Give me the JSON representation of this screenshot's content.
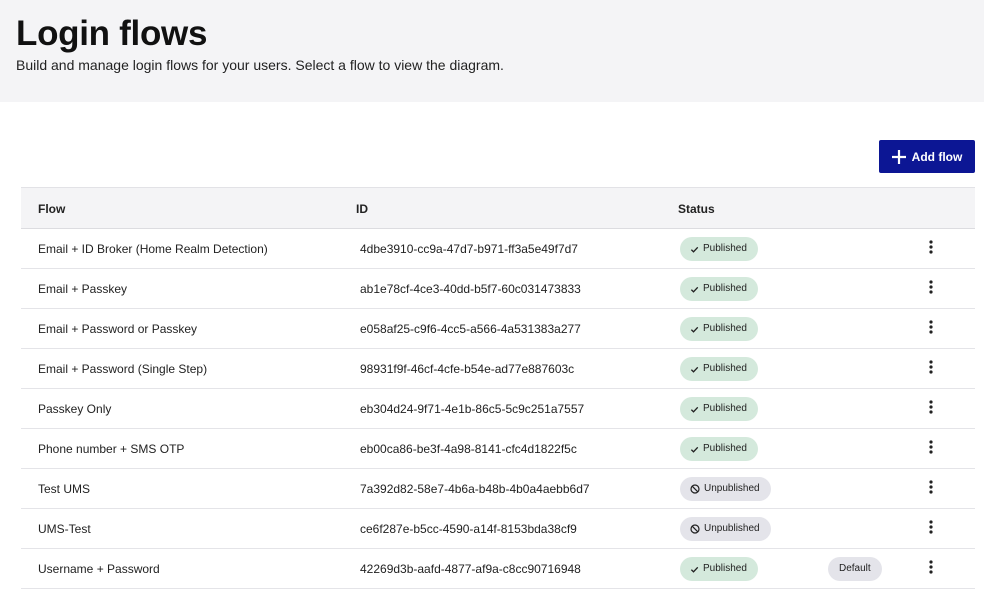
{
  "header": {
    "title": "Login flows",
    "subtitle": "Build and manage login flows for your users. Select a flow to view the diagram."
  },
  "toolbar": {
    "add_label": "Add flow",
    "add_icon": "plus-icon"
  },
  "table": {
    "columns": [
      "Flow",
      "ID",
      "Status"
    ],
    "rows": [
      {
        "flow": "Email + ID Broker (Home Realm Detection)",
        "id": "4dbe3910-cc9a-47d7-b971-ff3a5e49f7d7",
        "status": "Published",
        "default": ""
      },
      {
        "flow": "Email + Passkey",
        "id": "ab1e78cf-4ce3-40dd-b5f7-60c031473833",
        "status": "Published",
        "default": ""
      },
      {
        "flow": "Email + Password or Passkey",
        "id": "e058af25-c9f6-4cc5-a566-4a531383a277",
        "status": "Published",
        "default": ""
      },
      {
        "flow": "Email + Password (Single Step)",
        "id": "98931f9f-46cf-4cfe-b54e-ad77e887603c",
        "status": "Published",
        "default": ""
      },
      {
        "flow": "Passkey Only",
        "id": "eb304d24-9f71-4e1b-86c5-5c9c251a7557",
        "status": "Published",
        "default": ""
      },
      {
        "flow": "Phone number + SMS OTP",
        "id": "eb00ca86-be3f-4a98-8141-cfc4d1822f5c",
        "status": "Published",
        "default": ""
      },
      {
        "flow": "Test UMS",
        "id": "7a392d82-58e7-4b6a-b48b-4b0a4aebb6d7",
        "status": "Unpublished",
        "default": ""
      },
      {
        "flow": "UMS-Test",
        "id": "ce6f287e-b5cc-4590-a14f-8153bda38cf9",
        "status": "Unpublished",
        "default": ""
      },
      {
        "flow": "Username + Password",
        "id": "42269d3b-aafd-4877-af9a-c8cc90716948",
        "status": "Published",
        "default": "Default"
      }
    ]
  },
  "colors": {
    "primary_button": "#0c1694",
    "published_badge": "#d4e9dc",
    "unpublished_badge": "#e4e4ea",
    "header_bg": "#f4f4f6"
  }
}
